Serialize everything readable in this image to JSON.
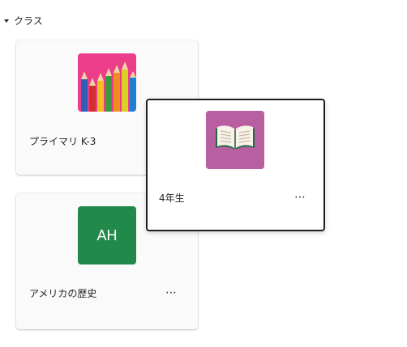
{
  "section": {
    "title": "クラス",
    "caret_icon": "caret-down-icon"
  },
  "cards": [
    {
      "name": "プライマリ K-3",
      "thumbnail_icon": "colored-pencils-icon",
      "thumb_color": "#ec3d8a"
    },
    {
      "name": "4年生",
      "thumbnail_icon": "open-book-icon",
      "thumb_color": "#b95ea0",
      "more_label": "⋯"
    },
    {
      "name": "アメリカの歴史",
      "thumbnail_initials": "AH",
      "thumb_color": "#218a4b",
      "more_label": "⋯"
    }
  ]
}
